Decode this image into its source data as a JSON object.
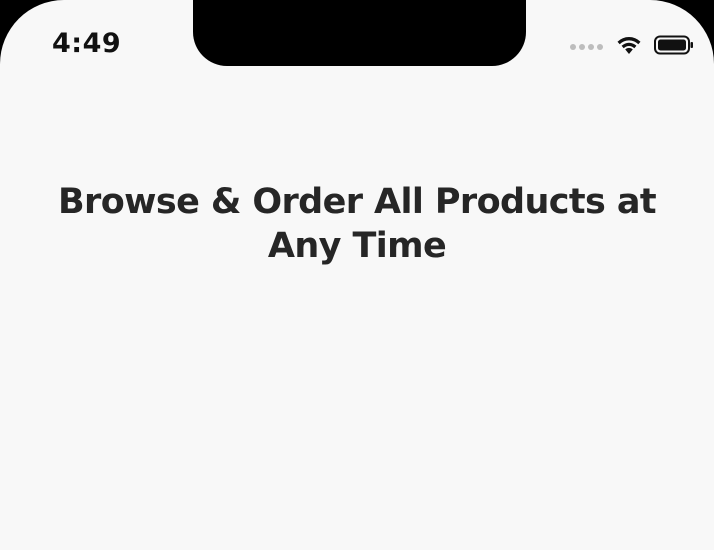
{
  "status_bar": {
    "time": "4:49",
    "icons": [
      "signal-icon",
      "wifi-icon",
      "battery-icon"
    ]
  },
  "main": {
    "headline": "Browse & Order All Products at Any Time"
  },
  "colors": {
    "background": "#f8f8f8",
    "text": "#262626",
    "notch": "#000000"
  }
}
